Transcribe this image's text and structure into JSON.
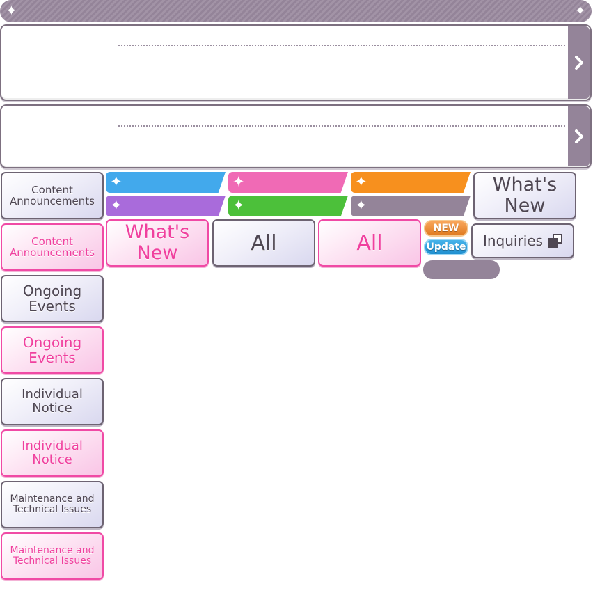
{
  "header": {
    "left_sparkle": "✦",
    "right_sparkle": "✦"
  },
  "notices": [
    {
      "title": "",
      "body": ""
    },
    {
      "title": "",
      "body": ""
    }
  ],
  "category_tabs": [
    {
      "label_line1": "Content",
      "label_line2": "Announcements",
      "state": "default"
    },
    {
      "label_line1": "Content",
      "label_line2": "Announcements",
      "state": "selected"
    },
    {
      "label_line1": "Ongoing",
      "label_line2": "Events",
      "state": "default"
    },
    {
      "label_line1": "Ongoing",
      "label_line2": "Events",
      "state": "selected"
    },
    {
      "label_line1": "Individual",
      "label_line2": "Notice",
      "state": "default"
    },
    {
      "label_line1": "Individual",
      "label_line2": "Notice",
      "state": "selected"
    },
    {
      "label_line1": "Maintenance and",
      "label_line2": "Technical Issues",
      "state": "default"
    },
    {
      "label_line1": "Maintenance and",
      "label_line2": "Technical Issues",
      "state": "selected"
    }
  ],
  "color_tags": [
    {
      "color": "#42a9ec",
      "icon": "sparkle-icon"
    },
    {
      "color": "#f06ab5",
      "icon": "sparkle-icon"
    },
    {
      "color": "#f7901e",
      "icon": "sparkle-icon"
    },
    {
      "color": "#a96bdb",
      "icon": "sparkle-icon"
    },
    {
      "color": "#4cc03a",
      "icon": "sparkle-icon"
    },
    {
      "color": "#948499",
      "icon": "sparkle-icon"
    }
  ],
  "buttons": {
    "whats_new_selected": {
      "line1": "What's",
      "line2": "New"
    },
    "all_default": "All",
    "all_selected": "All",
    "whats_new_default": {
      "line1": "What's",
      "line2": "New"
    },
    "inquiries": "Inquiries"
  },
  "badges": {
    "new": "NEW",
    "update": "Update"
  },
  "colors": {
    "accent_pink": "#f04aa5",
    "frame_grey": "#6d6372",
    "bar_grey": "#948499"
  }
}
